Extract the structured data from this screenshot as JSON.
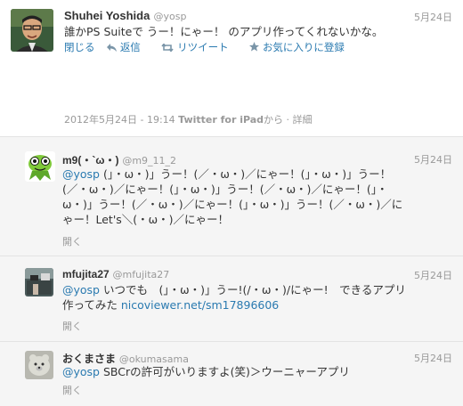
{
  "main_tweet": {
    "name": "Shuhei Yoshida",
    "handle": "@yosp",
    "time": "5月24日",
    "text": "誰かPS Suiteで うー！にゃー！ のアプリ作ってくれないかな。",
    "actions": {
      "close": "閉じる",
      "reply": "返信",
      "retweet": "リツイート",
      "favorite": "お気に入りに登録"
    },
    "timestamp": "2012年5月24日 - 19:14",
    "via_prefix": "Twitter for iPad",
    "via_suffix": "から",
    "details": "詳細"
  },
  "replies": [
    {
      "name": "m9(・`ω・)",
      "handle": "@m9_11_2",
      "time": "5月24日",
      "mention": "@yosp",
      "text_lines": [
        " (」・ω・)」うー！(／・ω・)／にゃー！(」・ω・)」うー！",
        "(／・ω・)／にゃー！(」・ω・)」うー！(／・ω・)／にゃー！(」・",
        "ω・)」うー！(／・ω・)／にゃー！(」・ω・)」うー！(／・ω・)／に",
        "ゃー！Let's＼(・ω・)／にゃー！"
      ],
      "open": "開く"
    },
    {
      "name": "mfujita27",
      "handle": "@mfujita27",
      "time": "5月24日",
      "mention": "@yosp",
      "text_line1": " いつでも　(」・ω・)」うー!(/・ω・)/にゃー!　できるアプリ",
      "text_line2": "作ってみた ",
      "link": "nicoviewer.net/sm17896606",
      "open": "開く"
    },
    {
      "name": "おくまさま",
      "handle": "@okumasama",
      "time": "5月24日",
      "mention": "@yosp",
      "text": " SBCrの許可がいりますよ(笑)＞ウーニャーアプリ",
      "open": "開く"
    }
  ],
  "colors": {
    "link": "#2a7ab0",
    "muted": "#999999",
    "reply_bg": "#f5f5f5"
  },
  "icons": [
    "reply-arrow-icon",
    "retweet-icon",
    "star-icon"
  ]
}
